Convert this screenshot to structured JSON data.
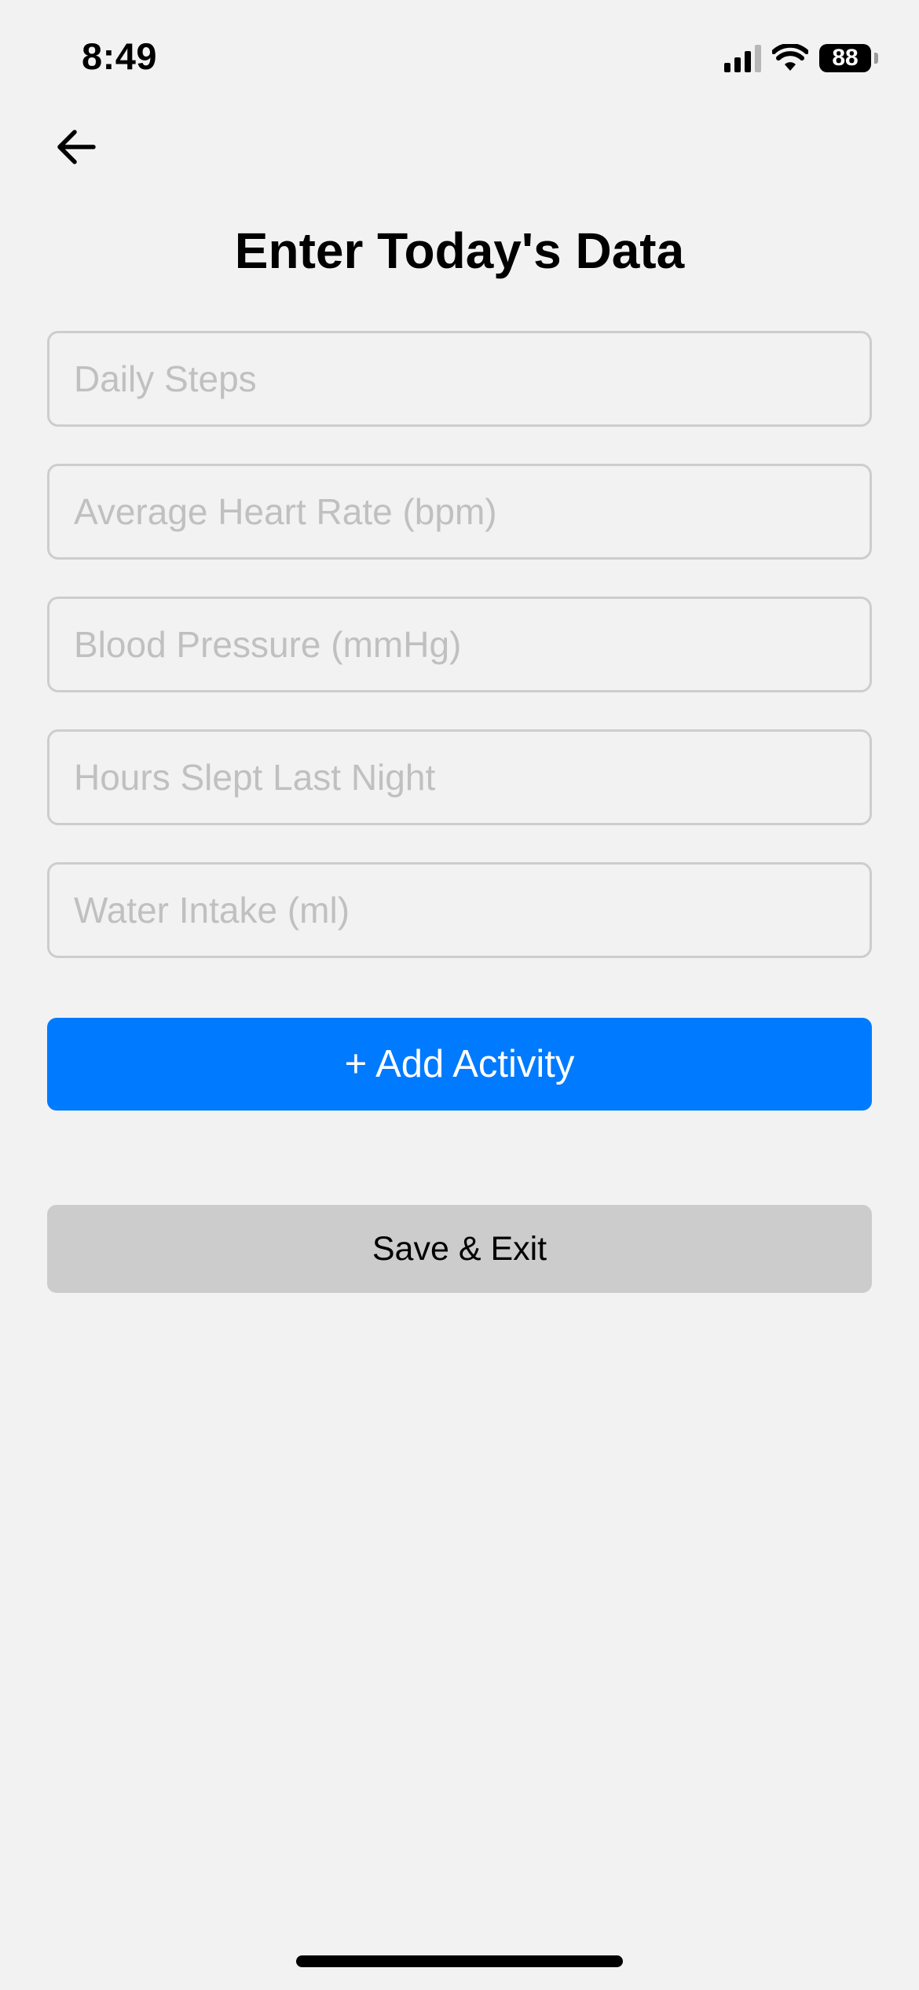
{
  "status_bar": {
    "time": "8:49",
    "battery_level": "88",
    "icons": [
      "cellular-signal-icon",
      "wifi-icon",
      "battery-icon"
    ]
  },
  "header": {
    "back_icon": "arrow-left-icon",
    "title": "Enter Today's Data"
  },
  "form": {
    "fields": [
      {
        "placeholder": "Daily Steps",
        "value": ""
      },
      {
        "placeholder": "Average Heart Rate (bpm)",
        "value": ""
      },
      {
        "placeholder": "Blood Pressure (mmHg)",
        "value": ""
      },
      {
        "placeholder": "Hours Slept Last Night",
        "value": ""
      },
      {
        "placeholder": "Water Intake (ml)",
        "value": ""
      }
    ]
  },
  "actions": {
    "add_activity_label": "+ Add Activity",
    "save_exit_label": "Save & Exit"
  },
  "colors": {
    "background": "#f2f2f2",
    "primary": "#007aff",
    "secondary_button": "#cccccc",
    "field_border": "#cdcdcd",
    "placeholder": "#c0c0c0"
  }
}
